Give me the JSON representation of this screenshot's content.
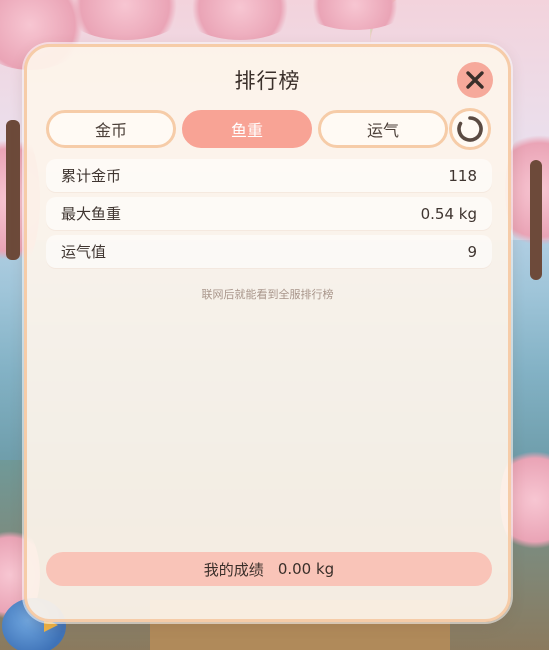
{
  "leaderboard": {
    "title": "排行榜",
    "tabs": [
      {
        "label": "金币",
        "active": false
      },
      {
        "label": "鱼重",
        "active": true
      },
      {
        "label": "运气",
        "active": false
      }
    ],
    "stats": [
      {
        "label": "累计金币",
        "value": "118"
      },
      {
        "label": "最大鱼重",
        "value": "0.54 kg"
      },
      {
        "label": "运气值",
        "value": "9"
      }
    ],
    "hint": "联网后就能看到全服排行榜",
    "my_score": {
      "label": "我的成绩",
      "value": "0.00 kg"
    },
    "icons": {
      "close": "close-icon",
      "refresh": "refresh-icon"
    }
  },
  "colors": {
    "accent": "#f8a395",
    "panel_bg": "#fdf4eb",
    "panel_border": "#f6cca8",
    "my_score_bg": "#f9c4b8"
  }
}
